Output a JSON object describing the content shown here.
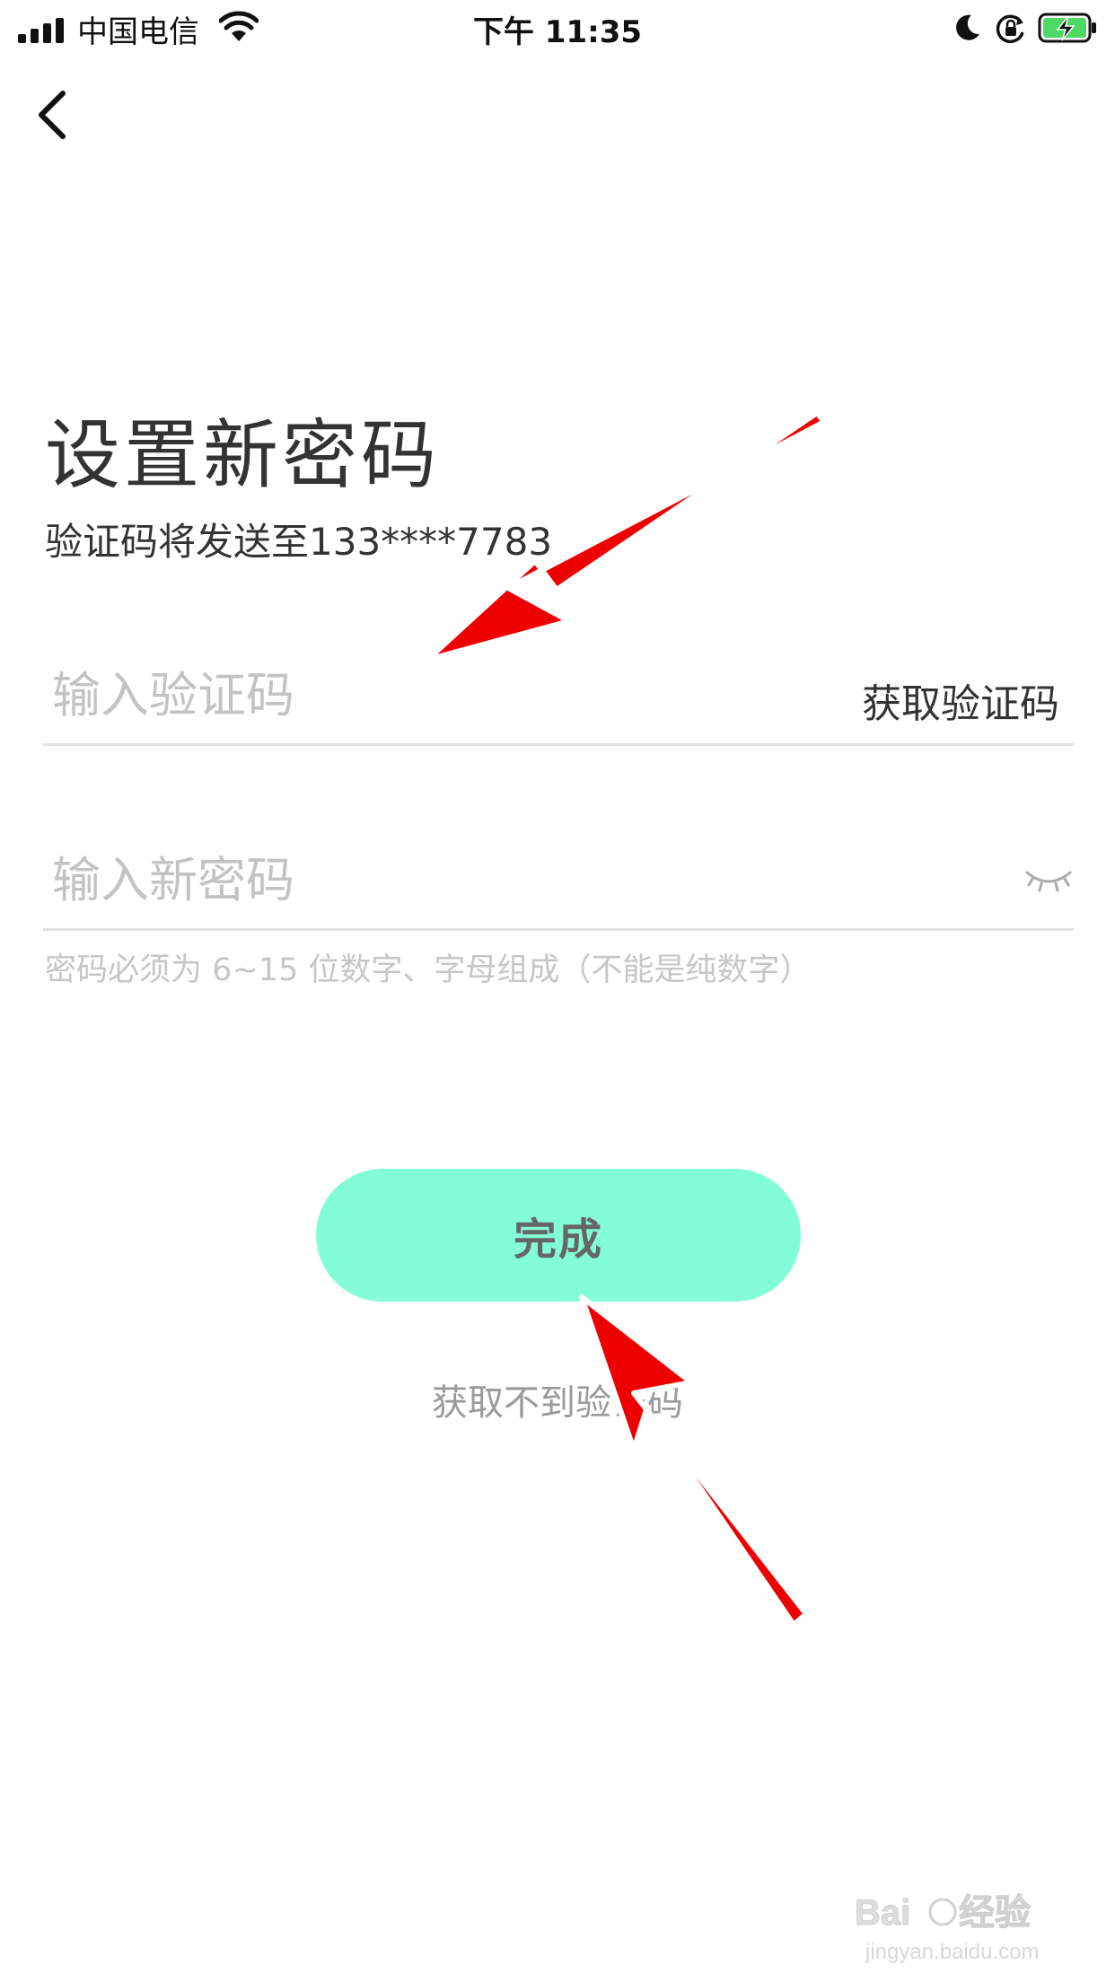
{
  "status_bar": {
    "carrier": "中国电信",
    "time": "下午 11:35"
  },
  "header": {
    "back_icon": "chevron-left-icon"
  },
  "main": {
    "title": "设置新密码",
    "subtitle": "验证码将发送至133****7783",
    "code_field": {
      "placeholder": "输入验证码",
      "value": "",
      "action_label": "获取验证码"
    },
    "password_field": {
      "placeholder": "输入新密码",
      "value": "",
      "toggle_icon": "eye-closed-icon"
    },
    "hint": "密码必须为 6~15 位数字、字母组成（不能是纯数字）",
    "done_label": "完成",
    "no_code_link": "获取不到验证码"
  },
  "annotations": {
    "arrow_color": "#ee0000"
  },
  "watermark": {
    "brand": "Baidu经验",
    "url": "jingyan.baidu.com"
  },
  "colors": {
    "button_bg": "#83fdd7",
    "battery_green": "#4cd964"
  }
}
